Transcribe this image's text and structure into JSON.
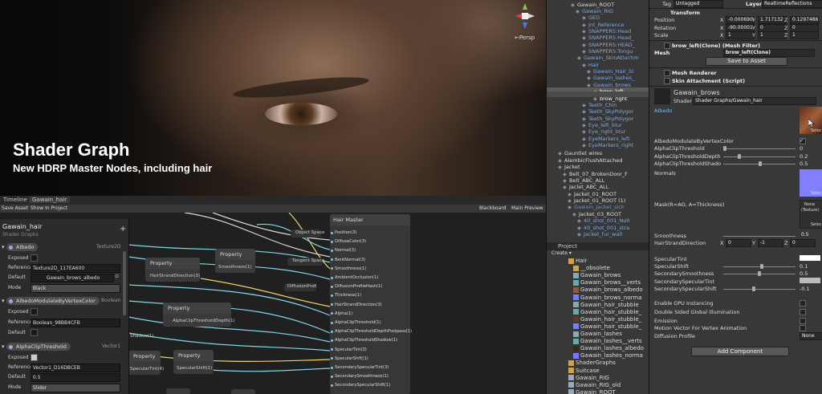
{
  "viewport": {
    "title": "Shader Graph",
    "subtitle": "New HDRP Master Nodes, including hair",
    "persp_label": "←Persp"
  },
  "graph_editor": {
    "tabs": [
      "Timeline",
      "Gawain_hair"
    ],
    "toolbar": {
      "save_asset": "Save Asset",
      "show_in_project": "Show In Project",
      "blackboard": "Blackboard",
      "main_preview": "Main Preview"
    },
    "blackboard": {
      "title": "Gawain_hair",
      "subtitle": "Shader Graphs",
      "add_symbol": "+",
      "properties": [
        {
          "name": "Albedo",
          "type": "Texture2D",
          "exposed_label": "Exposed",
          "reference_label": "Reference",
          "reference": "Texture2D_117EA600",
          "default_label": "Default",
          "default": "Gawain_brows_albedo",
          "mode_label": "Mode",
          "mode": "Black"
        },
        {
          "name": "AlbedoModulateByVertexColor",
          "type": "Boolean",
          "exposed_label": "Exposed",
          "reference_label": "Reference",
          "reference": "Boolean_98BB4CFB",
          "default_label": "Default"
        },
        {
          "name": "AlphaClipThreshold",
          "type": "Vector1",
          "exposed_label": "Exposed",
          "reference_label": "Reference",
          "reference": "Vector1_D16DBCEB",
          "default_label": "Default",
          "default": "0.5",
          "mode_label": "Mode",
          "mode": "Slider"
        }
      ]
    },
    "nodes": {
      "property_title": "Property",
      "hair_strand_direction": "HairStrandDirection(3)",
      "smoothness": "Smoothness(1)",
      "alpha_clip_depth": "AlphaClipThresholdDepth(1)",
      "specular_tint": "SpecularTint(4)",
      "specular_shift": "SpecularShift(1)",
      "shadow_partial": "Shadow(1)",
      "diffusion_profile": "DiffusionProfi",
      "object_space": "Object Space",
      "tangent_space": "Tangent Space"
    },
    "master": {
      "title": "Hair Master",
      "ports": [
        "Position(3)",
        "DiffuseColor(3)",
        "Normal(3)",
        "BentNormal(3)",
        "Smoothness(1)",
        "AmbientOcclusion(1)",
        "DiffusionProfileHash(1)",
        "Thickness(1)",
        "HairStrandDirection(3)",
        "Alpha(1)",
        "AlphaClipThreshold(1)",
        "AlphaClipThresholdDepthPostpass(1)",
        "AlphaClipThresholdShadow(1)",
        "SpecularTint(3)",
        "SpecularShift(1)",
        "SecondarySpecularTint(3)",
        "SecondarySmoothness(1)",
        "SecondarySpecularShift(1)"
      ]
    }
  },
  "hierarchy": {
    "items": [
      "Gawain_ROOT",
      "Gawain_RIG",
      "GEO",
      "jnt_Reference",
      "SNAPPERS:Head",
      "SNAPPERS:Head_",
      "SNAPPERS:HEAD_",
      "SNAPPERS:Tongu",
      "Gawain_SkinAttachm",
      "Hair",
      "Gawain_Hair_SI",
      "Gawain_lashes_",
      "Gawain_brows_",
      "brow_left",
      "brow_right",
      "Teeth_Chin",
      "Teeth_SkyPolygor",
      "Teeth_SkyPolygor",
      "Eye_left_blur",
      "Eye_right_blur",
      "EyeMarkers_left",
      "EyeMarkers_right",
      "Gauntlet wires",
      "AlembicFlushAttached",
      "Jacket",
      "Belt_07_BrokenDoor_F",
      "Belt_ABC_ALL",
      "Jaclet_ABC_ALL",
      "Jacket_01_ROOT",
      "Jacket_01_ROOT (1)",
      "Gawain_jacket_sick",
      "Jacket_03_ROOT",
      "40_shot_001_No0",
      "40_shot_001_stra",
      "Jacket_fur_wall"
    ]
  },
  "project": {
    "tab": "Project",
    "create_label": "Create ▾",
    "items": [
      "Hair",
      "__obsolete",
      "Gawain_brows",
      "Gawain_brows__verts",
      "Gawain_brows_albedo",
      "Gawain_brows_norma",
      "Gawain_hair_stubble",
      "Gawain_hair_stubble_",
      "Gawain_hair_stubble_",
      "Gawain_hair_stubble_",
      "Gawain_lashes",
      "Gawain_lashes__verts",
      "Gawain_lashes_albedo",
      "Gawain_lashes_norma",
      "ShaderGraphs",
      "Suitcase",
      "Gawain_RIG",
      "Gawain_RIG_old",
      "Gawain_ROOT"
    ]
  },
  "inspector": {
    "tag_label": "Tag",
    "tag_value": "Untagged",
    "layer_label": "Layer",
    "layer_value": "RealtimeReflections",
    "transform": {
      "title": "Transform",
      "position_label": "Position",
      "position": [
        "-0.0006902",
        "1.717132",
        "0.1297486"
      ],
      "rotation_label": "Rotation",
      "rotation": [
        "-90.00001",
        "0",
        "0"
      ],
      "scale_label": "Scale",
      "scale": [
        "1",
        "1",
        "1"
      ],
      "axes": [
        "X",
        "Y",
        "Z"
      ]
    },
    "mesh_filter": {
      "title": "brow_left(Clone) (Mesh Filter)",
      "mesh_label": "Mesh",
      "mesh_value": "brow_left(Clone)",
      "save_button": "Save to Asset"
    },
    "mesh_renderer": "Mesh Renderer",
    "skin_attachment": "Skin Attachment (Script)",
    "material": {
      "name": "Gawain_brows",
      "shader_label": "Shader",
      "shader_value": "Shader Graphs/Gawain_hair"
    },
    "props": {
      "albedo": "Albedo",
      "select": "Selec",
      "albedo_modulate": "AlbedoModulateByVertexColor",
      "alpha_clip": "AlphaClipThreshold",
      "alpha_clip_value": "0",
      "alpha_clip_depth": "AlphaClipThresholdDepth",
      "alpha_clip_depth_value": "0.2",
      "alpha_clip_shadow": "AlphaClipThresholdShado",
      "alpha_clip_shadow_value": "0.5",
      "normals": "Normals",
      "mask": "Mask(R=AO, A=Thickness)",
      "mask_none": "None",
      "mask_texture": "(Texture)",
      "smoothness": "Smoothness",
      "smoothness_value": "0.5",
      "hair_strand_direction": "HairStrandDirection",
      "hsd": [
        "0",
        "-1",
        "0"
      ],
      "specular_tint": "SpecularTint",
      "specular_shift": "SpecularShift",
      "specular_shift_value": "0.1",
      "secondary_smoothness": "SecondarySmoothness",
      "secondary_smoothness_value": "0.5",
      "secondary_specular_tint": "SecondarySpecularTint",
      "secondary_specular_shift": "SecondarySpecularShift",
      "secondary_specular_shift_value": "-0.1",
      "gpu_instancing": "Enable GPU Instancing",
      "double_sided_gi": "Double Sided Global Illumination",
      "emission": "Emission",
      "motion_vector": "Motion Vector For Vertex Animation",
      "diffusion_profile": "Diffusion Profile",
      "diffusion_profile_value": "None",
      "add_component": "Add Component"
    },
    "colors": {
      "albedo_swatch": "#7a4a2e",
      "normal_swatch": "#8080ff",
      "white_swatch": "#ffffff"
    }
  }
}
